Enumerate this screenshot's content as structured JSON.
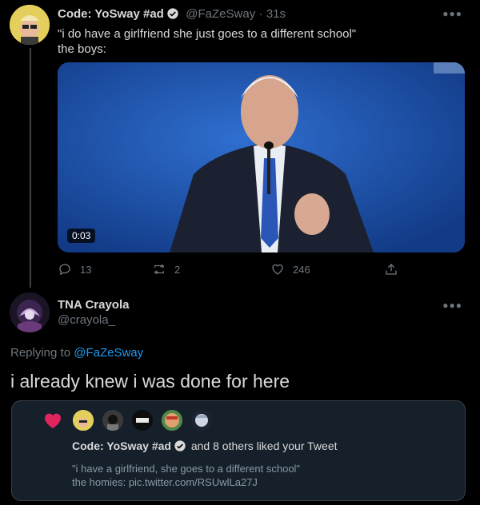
{
  "tweet": {
    "name": "Code: YoSway #ad",
    "handle": "@FaZeSway",
    "time": "· 31s",
    "line1": "\"i do have a girlfriend she just goes to a different school\"",
    "line2": "the boys:",
    "video_time": "0:03",
    "replies": "13",
    "retweets": "2",
    "likes": "246"
  },
  "reply": {
    "name": "TNA Crayola",
    "handle": "@crayola_",
    "replying_prefix": "Replying to",
    "replying_to": "@FaZeSway",
    "text": "i already knew i was done for here"
  },
  "embed": {
    "liked_name": "Code: YoSway #ad",
    "liked_suffix": "and 8 others liked your Tweet",
    "quote_line1": "\"i have a girlfriend, she goes to a different school\"",
    "quote_line2": "the homies: pic.twitter.com/RSUwlLa27J"
  },
  "icons": {
    "more": "more-dots-icon",
    "verified": "verified-badge-icon",
    "reply": "reply-icon",
    "retweet": "retweet-icon",
    "like": "heart-icon",
    "share": "share-icon",
    "liked": "heart-filled-icon"
  },
  "colors": {
    "background": "#000000",
    "accent": "#1d9bf0",
    "like_red": "#e0245e",
    "muted": "#6e767d",
    "text": "#d9d9d9"
  }
}
